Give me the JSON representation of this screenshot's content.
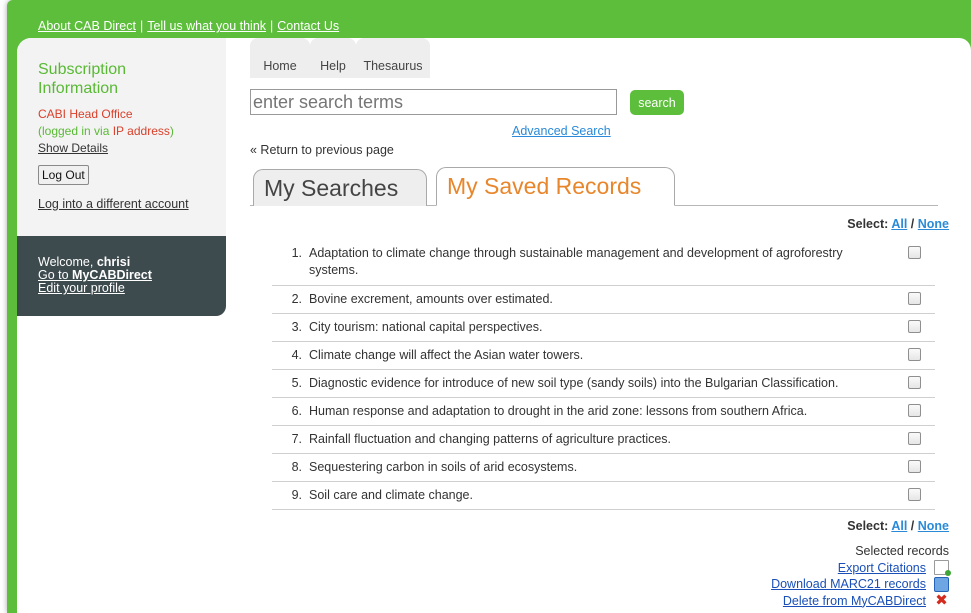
{
  "top_links": {
    "about": "About CAB Direct",
    "tell_us": "Tell us what you think",
    "contact": "Contact Us",
    "separator": "|"
  },
  "sidebar": {
    "subscription_title": "Subscription Information",
    "org_name": "CABI Head Office",
    "logged_in_prefix": "(logged in via ",
    "ip_label": "IP address",
    "logged_in_suffix": ")",
    "show_details": "Show Details",
    "logout_label": "Log Out",
    "other_account": "Log into a different account",
    "welcome_prefix": "Welcome, ",
    "username": "chrisi",
    "go_to_prefix": "Go to ",
    "mycab": "MyCABDirect",
    "edit_profile": "Edit your profile"
  },
  "nav": {
    "home": "Home",
    "help": "Help",
    "thesaurus": "Thesaurus"
  },
  "search": {
    "placeholder": "enter search terms",
    "button": "search",
    "advanced": "Advanced Search"
  },
  "return_link": "« Return to previous page",
  "tabs": {
    "searches": "My Searches",
    "saved": "My Saved Records"
  },
  "select": {
    "label": "Select:",
    "all": "All",
    "slash": "/",
    "none": "None"
  },
  "records": [
    {
      "num": "1.",
      "title": "Adaptation to climate change through sustainable management and development of agroforestry systems."
    },
    {
      "num": "2.",
      "title": "Bovine excrement, amounts over estimated."
    },
    {
      "num": "3.",
      "title": "City tourism: national capital perspectives."
    },
    {
      "num": "4.",
      "title": "Climate change will affect the Asian water towers."
    },
    {
      "num": "5.",
      "title": "Diagnostic evidence for introduce of new soil type (sandy soils) into the Bulgarian Classification."
    },
    {
      "num": "6.",
      "title": "Human response and adaptation to drought in the arid zone: lessons from southern Africa."
    },
    {
      "num": "7.",
      "title": "Rainfall fluctuation and changing patterns of agriculture practices."
    },
    {
      "num": "8.",
      "title": "Sequestering carbon in soils of arid ecosystems."
    },
    {
      "num": "9.",
      "title": "Soil care and climate change."
    }
  ],
  "selected_actions": {
    "label": "Selected records",
    "export": "Export Citations",
    "download": "Download MARC21 records",
    "delete": "Delete from MyCABDirect"
  }
}
